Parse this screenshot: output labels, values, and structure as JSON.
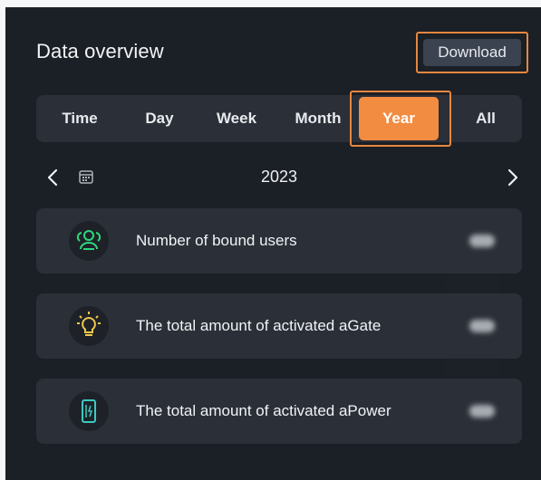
{
  "header": {
    "title": "Data overview",
    "download_label": "Download"
  },
  "tabs": [
    {
      "label": "Time",
      "selected": false
    },
    {
      "label": "Day",
      "selected": false
    },
    {
      "label": "Week",
      "selected": false
    },
    {
      "label": "Month",
      "selected": false
    },
    {
      "label": "Year",
      "selected": true
    },
    {
      "label": "All",
      "selected": false
    }
  ],
  "date_nav": {
    "current": "2023",
    "prev_icon": "chevron-left-icon",
    "next_icon": "chevron-right-icon",
    "calendar_icon": "calendar-icon"
  },
  "cards": [
    {
      "label": "Number of bound users",
      "icon": "users-icon",
      "value": ""
    },
    {
      "label": "The total amount of activated aGate",
      "icon": "lightbulb-icon",
      "value": ""
    },
    {
      "label": "The total amount of activated aPower",
      "icon": "battery-icon",
      "value": ""
    }
  ],
  "colors": {
    "accent": "#f28c41",
    "highlight_outline": "#e6873f",
    "panel_bg": "#1b1f26",
    "card_bg": "#2b3038",
    "user_icon": "#2dd77a",
    "bulb_icon": "#f0c84a",
    "battery_icon": "#3ec9c0"
  }
}
